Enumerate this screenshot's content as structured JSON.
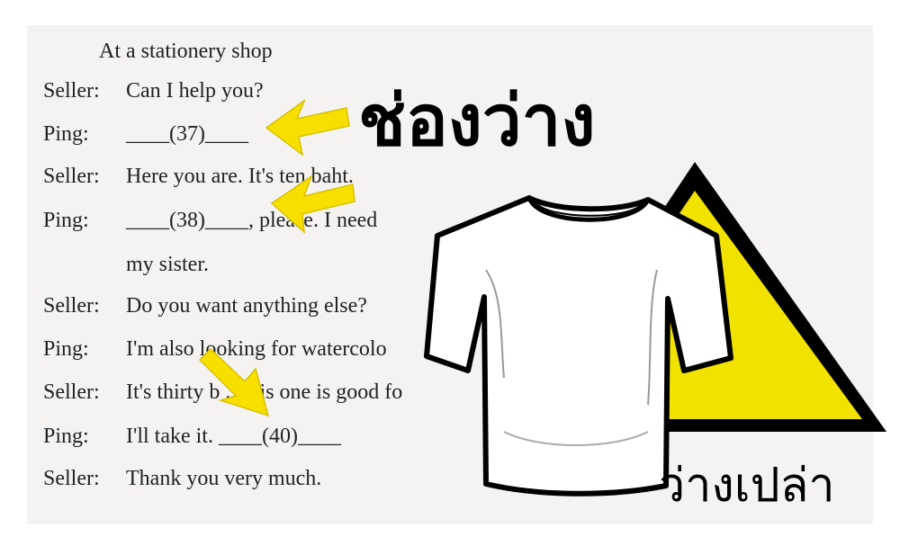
{
  "document": {
    "title": "At a stationery shop",
    "dialogue": [
      {
        "speaker": "Seller:",
        "text": "Can I help you?"
      },
      {
        "speaker": "Ping:",
        "text": "____(37)____"
      },
      {
        "speaker": "Seller:",
        "text": "Here you are.  It's ten baht."
      },
      {
        "speaker": "Ping:",
        "text": "____(38)____, please.  I need"
      },
      {
        "speaker": "",
        "text": "my sister."
      },
      {
        "speaker": "Seller:",
        "text": "Do you want anything else?"
      },
      {
        "speaker": "Ping:",
        "text": "I'm also looking for watercolo"
      },
      {
        "speaker": "Seller:",
        "text": "It's thirty b   .  This one is good fo"
      },
      {
        "speaker": "Ping:",
        "text": "I'll take it.  ____(40)____"
      },
      {
        "speaker": "Seller:",
        "text": "Thank you very much."
      }
    ]
  },
  "overlay": {
    "heading_thai": "ช่องว่าง",
    "caption_thai": "ว่างเปล่า",
    "arrow_color": "#f7e000",
    "warning_color": "#f2e200",
    "icons": [
      "arrow-icon",
      "tshirt-icon",
      "warning-triangle-icon"
    ]
  }
}
